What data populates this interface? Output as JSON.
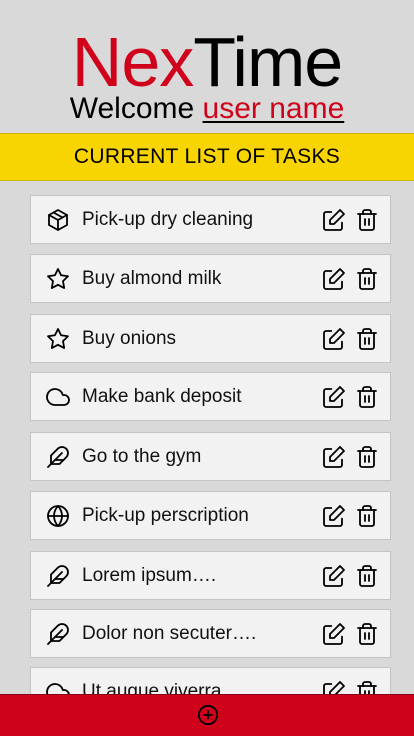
{
  "header": {
    "logo_part1": "Nex",
    "logo_part2": "Time",
    "welcome_label": "Welcome",
    "username": "user name"
  },
  "banner": {
    "title": "CURRENT LIST OF TASKS"
  },
  "tasks": [
    {
      "label": "Pick-up dry cleaning",
      "icon": "package-icon"
    },
    {
      "label": "Buy almond milk",
      "icon": "star-icon"
    },
    {
      "label": "Buy onions",
      "icon": "star-icon"
    },
    {
      "label": "Make bank deposit",
      "icon": "cloud-icon"
    },
    {
      "label": "Go to the gym",
      "icon": "feather-icon"
    },
    {
      "label": "Pick-up perscription",
      "icon": "globe-icon"
    },
    {
      "label": "Lorem ipsum….",
      "icon": "feather-icon"
    },
    {
      "label": "Dolor non secuter….",
      "icon": "feather-icon"
    },
    {
      "label": "Ut augue viverra…",
      "icon": "cloud-icon"
    }
  ],
  "task_actions": {
    "edit_icon": "edit-icon",
    "delete_icon": "trash-icon"
  },
  "footer": {
    "add_icon": "plus-circle-icon"
  },
  "colors": {
    "brand_red": "#d0021b",
    "banner_yellow": "#f8d500",
    "background": "#d9d9d9",
    "card": "#f2f2f2"
  }
}
